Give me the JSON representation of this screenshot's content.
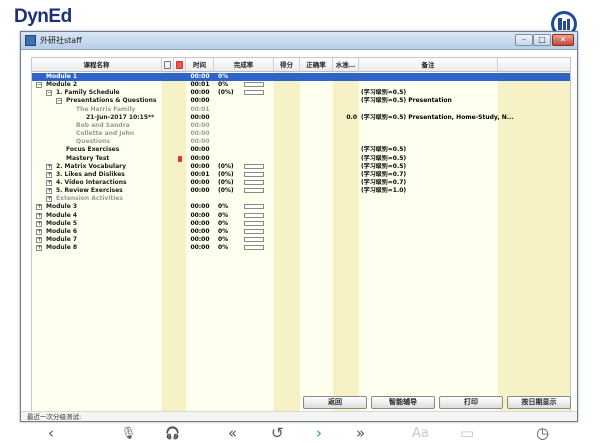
{
  "brand": {
    "name": "DynEd"
  },
  "window": {
    "title": "外研社staff",
    "min_glyph": "–",
    "max_glyph": "□",
    "close_glyph": "✕"
  },
  "columns": {
    "name": "课程名称",
    "time": "时间",
    "completion": "完成率",
    "score": "得分",
    "accuracy": "正确率",
    "level": "水准…",
    "notes": "备注"
  },
  "rows": [
    {
      "name": "Module 1",
      "indent": 0,
      "expander": "",
      "time": "00:00",
      "pct": "0%",
      "bar": false,
      "fill": 0,
      "level": "",
      "note": "",
      "selected": true,
      "muted": false,
      "lock": false
    },
    {
      "name": "Module 2",
      "indent": 0,
      "expander": "−",
      "time": "00:01",
      "pct": "0%",
      "bar": true,
      "fill": 0,
      "level": "",
      "note": "",
      "selected": false,
      "muted": false,
      "lock": false
    },
    {
      "name": "1. Family Schedule",
      "indent": 1,
      "expander": "−",
      "time": "00:00",
      "pct": "(0%)",
      "bar": true,
      "fill": 0,
      "level": "",
      "note": "(学习级别=0.5)",
      "selected": false,
      "muted": false,
      "lock": false
    },
    {
      "name": "Presentations & Questions",
      "indent": 2,
      "expander": "−",
      "time": "00:00",
      "pct": "",
      "bar": false,
      "fill": 0,
      "level": "",
      "note": "(学习级别=0.5) Presentation",
      "selected": false,
      "muted": false,
      "lock": false
    },
    {
      "name": "The Harris Family",
      "indent": 3,
      "expander": "",
      "time": "00:01",
      "pct": "",
      "bar": false,
      "fill": 0,
      "level": "",
      "note": "",
      "selected": false,
      "muted": true,
      "lock": false
    },
    {
      "name": "21-Jun-2017  10:15**",
      "indent": 4,
      "expander": "",
      "time": "00:00",
      "pct": "",
      "bar": false,
      "fill": 0,
      "level": "0.0",
      "note": "(学习级别=0.5) Presentation, Home-Study, N...",
      "selected": false,
      "muted": false,
      "lock": false
    },
    {
      "name": "Bob and Sandra",
      "indent": 3,
      "expander": "",
      "time": "00:00",
      "pct": "",
      "bar": false,
      "fill": 0,
      "level": "",
      "note": "",
      "selected": false,
      "muted": true,
      "lock": false
    },
    {
      "name": "Collette and John",
      "indent": 3,
      "expander": "",
      "time": "00:00",
      "pct": "",
      "bar": false,
      "fill": 0,
      "level": "",
      "note": "",
      "selected": false,
      "muted": true,
      "lock": false
    },
    {
      "name": "Questions",
      "indent": 3,
      "expander": "",
      "time": "00:00",
      "pct": "",
      "bar": false,
      "fill": 0,
      "level": "",
      "note": "",
      "selected": false,
      "muted": true,
      "lock": false
    },
    {
      "name": "Focus Exercises",
      "indent": 2,
      "expander": "",
      "time": "00:00",
      "pct": "",
      "bar": false,
      "fill": 0,
      "level": "",
      "note": "(学习级别=0.5)",
      "selected": false,
      "muted": false,
      "lock": false
    },
    {
      "name": "Mastery Test",
      "indent": 2,
      "expander": "",
      "time": "00:00",
      "pct": "",
      "bar": false,
      "fill": 0,
      "level": "",
      "note": "(学习级别=0.5)",
      "selected": false,
      "muted": false,
      "lock": true
    },
    {
      "name": "2. Matrix Vocabulary",
      "indent": 1,
      "expander": "+",
      "time": "00:00",
      "pct": "(0%)",
      "bar": true,
      "fill": 0,
      "level": "",
      "note": "(学习级别=0.5)",
      "selected": false,
      "muted": false,
      "lock": false
    },
    {
      "name": "3. Likes and Dislikes",
      "indent": 1,
      "expander": "+",
      "time": "00:01",
      "pct": "(0%)",
      "bar": true,
      "fill": 0,
      "level": "",
      "note": "(学习级别=0.7)",
      "selected": false,
      "muted": false,
      "lock": false
    },
    {
      "name": "4. Video Interactions",
      "indent": 1,
      "expander": "+",
      "time": "00:00",
      "pct": "(0%)",
      "bar": true,
      "fill": 0,
      "level": "",
      "note": "(学习级别=0.7)",
      "selected": false,
      "muted": false,
      "lock": false
    },
    {
      "name": "5. Review Exercises",
      "indent": 1,
      "expander": "+",
      "time": "00:00",
      "pct": "(0%)",
      "bar": true,
      "fill": 0,
      "level": "",
      "note": "(学习级别=1.0)",
      "selected": false,
      "muted": false,
      "lock": false
    },
    {
      "name": "Extension Activities",
      "indent": 1,
      "expander": "+",
      "time": "",
      "pct": "",
      "bar": false,
      "fill": 0,
      "level": "",
      "note": "",
      "selected": false,
      "muted": true,
      "lock": false
    },
    {
      "name": "Module 3",
      "indent": 0,
      "expander": "+",
      "time": "00:00",
      "pct": "0%",
      "bar": true,
      "fill": 0,
      "level": "",
      "note": "",
      "selected": false,
      "muted": false,
      "lock": false
    },
    {
      "name": "Module 4",
      "indent": 0,
      "expander": "+",
      "time": "00:00",
      "pct": "0%",
      "bar": true,
      "fill": 0,
      "level": "",
      "note": "",
      "selected": false,
      "muted": false,
      "lock": false
    },
    {
      "name": "Module 5",
      "indent": 0,
      "expander": "+",
      "time": "00:00",
      "pct": "0%",
      "bar": true,
      "fill": 0,
      "level": "",
      "note": "",
      "selected": false,
      "muted": false,
      "lock": false
    },
    {
      "name": "Module 6",
      "indent": 0,
      "expander": "+",
      "time": "00:00",
      "pct": "0%",
      "bar": true,
      "fill": 0,
      "level": "",
      "note": "",
      "selected": false,
      "muted": false,
      "lock": false
    },
    {
      "name": "Module 7",
      "indent": 0,
      "expander": "+",
      "time": "00:00",
      "pct": "0%",
      "bar": true,
      "fill": 0,
      "level": "",
      "note": "",
      "selected": false,
      "muted": false,
      "lock": false
    },
    {
      "name": "Module 8",
      "indent": 0,
      "expander": "+",
      "time": "00:00",
      "pct": "0%",
      "bar": true,
      "fill": 0,
      "level": "",
      "note": "",
      "selected": false,
      "muted": false,
      "lock": false
    }
  ],
  "buttons": {
    "back": "返回",
    "smart_tutor": "智能辅导",
    "print": "打印",
    "by_date": "按日期显示"
  },
  "status": {
    "text": "最近一次分级测试:"
  },
  "toolbar": {
    "back_glyph": "‹",
    "mic_glyph": "🎙",
    "headset_glyph": "🎧",
    "rewind_glyph": "«",
    "repeat_glyph": "↺",
    "next_glyph": "›",
    "forward_glyph": "»",
    "text_size_glyph": "Aa",
    "card_glyph": "▭",
    "clock_glyph": "◷"
  },
  "colors": {
    "brand": "#1d2f7a",
    "selection": "#2f63c8",
    "grid_bg": "#fffff0",
    "column_tint": "#f6f2c6",
    "next_arrow": "#3aa35a"
  }
}
